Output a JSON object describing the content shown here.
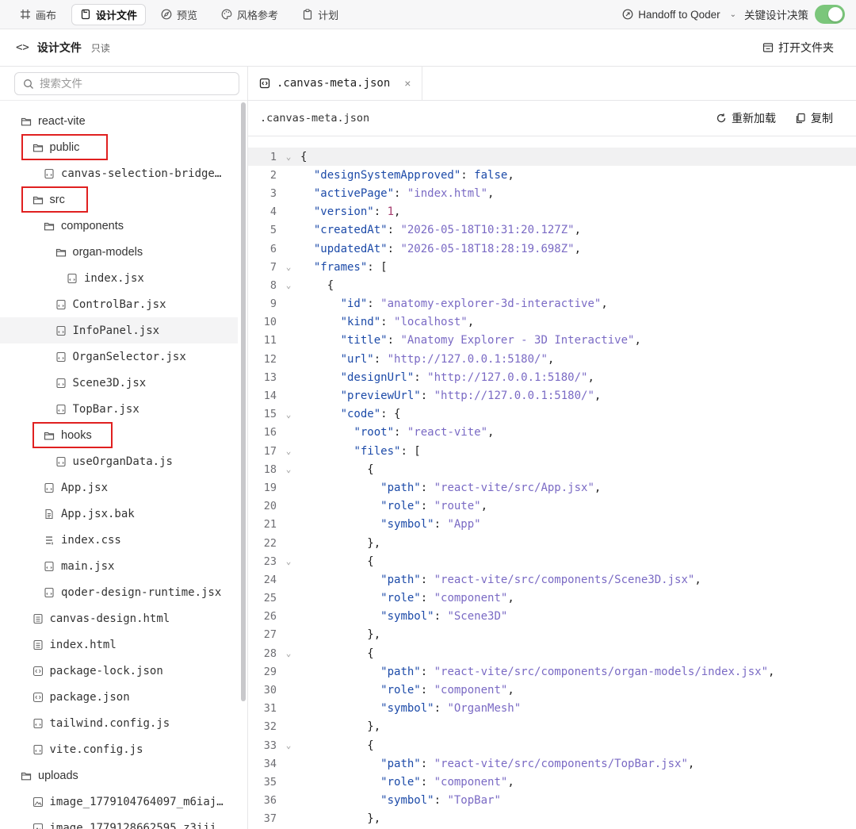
{
  "topnav": {
    "tabs": [
      {
        "label": "画布",
        "icon": "grid-icon",
        "active": false
      },
      {
        "label": "设计文件",
        "icon": "file-icon",
        "active": true
      },
      {
        "label": "预览",
        "icon": "compass-icon",
        "active": false
      },
      {
        "label": "风格参考",
        "icon": "palette-icon",
        "active": false
      },
      {
        "label": "计划",
        "icon": "clipboard-icon",
        "active": false
      }
    ],
    "handoff_label": "Handoff to Qoder",
    "decision_label": "关键设计决策",
    "decision_toggle_on": true,
    "toggle_color": "#7bc67b"
  },
  "subheader": {
    "title": "设计文件",
    "readonly": "只读",
    "open_folder": "打开文件夹"
  },
  "sidebar": {
    "search_placeholder": "搜索文件",
    "tree": [
      {
        "label": "react-vite",
        "type": "folder",
        "depth": 0
      },
      {
        "label": "public",
        "type": "folder",
        "depth": 1,
        "highlighted": true
      },
      {
        "label": "canvas-selection-bridge…",
        "type": "file",
        "depth": 2
      },
      {
        "label": "src",
        "type": "folder",
        "depth": 1,
        "highlighted": true
      },
      {
        "label": "components",
        "type": "folder",
        "depth": 2
      },
      {
        "label": "organ-models",
        "type": "folder",
        "depth": 3
      },
      {
        "label": "index.jsx",
        "type": "file",
        "depth": 4
      },
      {
        "label": "ControlBar.jsx",
        "type": "file",
        "depth": 3
      },
      {
        "label": "InfoPanel.jsx",
        "type": "file",
        "depth": 3,
        "selected": true
      },
      {
        "label": "OrganSelector.jsx",
        "type": "file",
        "depth": 3
      },
      {
        "label": "Scene3D.jsx",
        "type": "file",
        "depth": 3
      },
      {
        "label": "TopBar.jsx",
        "type": "file",
        "depth": 3
      },
      {
        "label": "hooks",
        "type": "folder",
        "depth": 2,
        "highlighted": true
      },
      {
        "label": "useOrganData.js",
        "type": "file",
        "depth": 3
      },
      {
        "label": "App.jsx",
        "type": "file",
        "depth": 2
      },
      {
        "label": "App.jsx.bak",
        "type": "doc",
        "depth": 2
      },
      {
        "label": "index.css",
        "type": "css",
        "depth": 2
      },
      {
        "label": "main.jsx",
        "type": "file",
        "depth": 2
      },
      {
        "label": "qoder-design-runtime.jsx",
        "type": "file",
        "depth": 2
      },
      {
        "label": "canvas-design.html",
        "type": "html",
        "depth": 1
      },
      {
        "label": "index.html",
        "type": "html",
        "depth": 1
      },
      {
        "label": "package-lock.json",
        "type": "json",
        "depth": 1
      },
      {
        "label": "package.json",
        "type": "json",
        "depth": 1
      },
      {
        "label": "tailwind.config.js",
        "type": "file",
        "depth": 1
      },
      {
        "label": "vite.config.js",
        "type": "file",
        "depth": 1
      },
      {
        "label": "uploads",
        "type": "folder",
        "depth": 0
      },
      {
        "label": "image_1779104764097_m6iaj…",
        "type": "image",
        "depth": 1
      },
      {
        "label": "image_1779128662595_z3iii…",
        "type": "image",
        "depth": 1
      }
    ]
  },
  "editor": {
    "tab_label": ".canvas-meta.json",
    "tab_close": "×",
    "file_name": ".canvas-meta.json",
    "reload_label": "重新加载",
    "copy_label": "复制",
    "lines": [
      {
        "n": "1",
        "fold": true,
        "current": true,
        "t": [
          [
            "p",
            "{"
          ]
        ]
      },
      {
        "n": "2",
        "t": [
          [
            "p",
            "  "
          ],
          [
            "k",
            "\"designSystemApproved\""
          ],
          [
            "p",
            ": "
          ],
          [
            "b",
            "false"
          ],
          [
            "p",
            ","
          ]
        ]
      },
      {
        "n": "3",
        "t": [
          [
            "p",
            "  "
          ],
          [
            "k",
            "\"activePage\""
          ],
          [
            "p",
            ": "
          ],
          [
            "s",
            "\"index.html\""
          ],
          [
            "p",
            ","
          ]
        ]
      },
      {
        "n": "4",
        "t": [
          [
            "p",
            "  "
          ],
          [
            "k",
            "\"version\""
          ],
          [
            "p",
            ": "
          ],
          [
            "n",
            "1"
          ],
          [
            "p",
            ","
          ]
        ]
      },
      {
        "n": "5",
        "t": [
          [
            "p",
            "  "
          ],
          [
            "k",
            "\"createdAt\""
          ],
          [
            "p",
            ": "
          ],
          [
            "s",
            "\"2026-05-18T10:31:20.127Z\""
          ],
          [
            "p",
            ","
          ]
        ]
      },
      {
        "n": "6",
        "t": [
          [
            "p",
            "  "
          ],
          [
            "k",
            "\"updatedAt\""
          ],
          [
            "p",
            ": "
          ],
          [
            "s",
            "\"2026-05-18T18:28:19.698Z\""
          ],
          [
            "p",
            ","
          ]
        ]
      },
      {
        "n": "7",
        "fold": true,
        "t": [
          [
            "p",
            "  "
          ],
          [
            "k",
            "\"frames\""
          ],
          [
            "p",
            ": ["
          ]
        ]
      },
      {
        "n": "8",
        "fold": true,
        "t": [
          [
            "p",
            "    {"
          ]
        ]
      },
      {
        "n": "9",
        "t": [
          [
            "p",
            "      "
          ],
          [
            "k",
            "\"id\""
          ],
          [
            "p",
            ": "
          ],
          [
            "s",
            "\"anatomy-explorer-3d-interactive\""
          ],
          [
            "p",
            ","
          ]
        ]
      },
      {
        "n": "10",
        "t": [
          [
            "p",
            "      "
          ],
          [
            "k",
            "\"kind\""
          ],
          [
            "p",
            ": "
          ],
          [
            "s",
            "\"localhost\""
          ],
          [
            "p",
            ","
          ]
        ]
      },
      {
        "n": "11",
        "t": [
          [
            "p",
            "      "
          ],
          [
            "k",
            "\"title\""
          ],
          [
            "p",
            ": "
          ],
          [
            "s",
            "\"Anatomy Explorer - 3D Interactive\""
          ],
          [
            "p",
            ","
          ]
        ]
      },
      {
        "n": "12",
        "t": [
          [
            "p",
            "      "
          ],
          [
            "k",
            "\"url\""
          ],
          [
            "p",
            ": "
          ],
          [
            "s",
            "\"http://127.0.0.1:5180/\""
          ],
          [
            "p",
            ","
          ]
        ]
      },
      {
        "n": "13",
        "t": [
          [
            "p",
            "      "
          ],
          [
            "k",
            "\"designUrl\""
          ],
          [
            "p",
            ": "
          ],
          [
            "s",
            "\"http://127.0.0.1:5180/\""
          ],
          [
            "p",
            ","
          ]
        ]
      },
      {
        "n": "14",
        "t": [
          [
            "p",
            "      "
          ],
          [
            "k",
            "\"previewUrl\""
          ],
          [
            "p",
            ": "
          ],
          [
            "s",
            "\"http://127.0.0.1:5180/\""
          ],
          [
            "p",
            ","
          ]
        ]
      },
      {
        "n": "15",
        "fold": true,
        "t": [
          [
            "p",
            "      "
          ],
          [
            "k",
            "\"code\""
          ],
          [
            "p",
            ": {"
          ]
        ]
      },
      {
        "n": "16",
        "t": [
          [
            "p",
            "        "
          ],
          [
            "k",
            "\"root\""
          ],
          [
            "p",
            ": "
          ],
          [
            "s",
            "\"react-vite\""
          ],
          [
            "p",
            ","
          ]
        ]
      },
      {
        "n": "17",
        "fold": true,
        "t": [
          [
            "p",
            "        "
          ],
          [
            "k",
            "\"files\""
          ],
          [
            "p",
            ": ["
          ]
        ]
      },
      {
        "n": "18",
        "fold": true,
        "t": [
          [
            "p",
            "          {"
          ]
        ]
      },
      {
        "n": "19",
        "t": [
          [
            "p",
            "            "
          ],
          [
            "k",
            "\"path\""
          ],
          [
            "p",
            ": "
          ],
          [
            "s",
            "\"react-vite/src/App.jsx\""
          ],
          [
            "p",
            ","
          ]
        ]
      },
      {
        "n": "20",
        "t": [
          [
            "p",
            "            "
          ],
          [
            "k",
            "\"role\""
          ],
          [
            "p",
            ": "
          ],
          [
            "s",
            "\"route\""
          ],
          [
            "p",
            ","
          ]
        ]
      },
      {
        "n": "21",
        "t": [
          [
            "p",
            "            "
          ],
          [
            "k",
            "\"symbol\""
          ],
          [
            "p",
            ": "
          ],
          [
            "s",
            "\"App\""
          ]
        ]
      },
      {
        "n": "22",
        "t": [
          [
            "p",
            "          },"
          ]
        ]
      },
      {
        "n": "23",
        "fold": true,
        "t": [
          [
            "p",
            "          {"
          ]
        ]
      },
      {
        "n": "24",
        "t": [
          [
            "p",
            "            "
          ],
          [
            "k",
            "\"path\""
          ],
          [
            "p",
            ": "
          ],
          [
            "s",
            "\"react-vite/src/components/Scene3D.jsx\""
          ],
          [
            "p",
            ","
          ]
        ]
      },
      {
        "n": "25",
        "t": [
          [
            "p",
            "            "
          ],
          [
            "k",
            "\"role\""
          ],
          [
            "p",
            ": "
          ],
          [
            "s",
            "\"component\""
          ],
          [
            "p",
            ","
          ]
        ]
      },
      {
        "n": "26",
        "t": [
          [
            "p",
            "            "
          ],
          [
            "k",
            "\"symbol\""
          ],
          [
            "p",
            ": "
          ],
          [
            "s",
            "\"Scene3D\""
          ]
        ]
      },
      {
        "n": "27",
        "t": [
          [
            "p",
            "          },"
          ]
        ]
      },
      {
        "n": "28",
        "fold": true,
        "t": [
          [
            "p",
            "          {"
          ]
        ]
      },
      {
        "n": "29",
        "t": [
          [
            "p",
            "            "
          ],
          [
            "k",
            "\"path\""
          ],
          [
            "p",
            ": "
          ],
          [
            "s",
            "\"react-vite/src/components/organ-models/index.jsx\""
          ],
          [
            "p",
            ","
          ]
        ]
      },
      {
        "n": "30",
        "t": [
          [
            "p",
            "            "
          ],
          [
            "k",
            "\"role\""
          ],
          [
            "p",
            ": "
          ],
          [
            "s",
            "\"component\""
          ],
          [
            "p",
            ","
          ]
        ]
      },
      {
        "n": "31",
        "t": [
          [
            "p",
            "            "
          ],
          [
            "k",
            "\"symbol\""
          ],
          [
            "p",
            ": "
          ],
          [
            "s",
            "\"OrganMesh\""
          ]
        ]
      },
      {
        "n": "32",
        "t": [
          [
            "p",
            "          },"
          ]
        ]
      },
      {
        "n": "33",
        "fold": true,
        "t": [
          [
            "p",
            "          {"
          ]
        ]
      },
      {
        "n": "34",
        "t": [
          [
            "p",
            "            "
          ],
          [
            "k",
            "\"path\""
          ],
          [
            "p",
            ": "
          ],
          [
            "s",
            "\"react-vite/src/components/TopBar.jsx\""
          ],
          [
            "p",
            ","
          ]
        ]
      },
      {
        "n": "35",
        "t": [
          [
            "p",
            "            "
          ],
          [
            "k",
            "\"role\""
          ],
          [
            "p",
            ": "
          ],
          [
            "s",
            "\"component\""
          ],
          [
            "p",
            ","
          ]
        ]
      },
      {
        "n": "36",
        "t": [
          [
            "p",
            "            "
          ],
          [
            "k",
            "\"symbol\""
          ],
          [
            "p",
            ": "
          ],
          [
            "s",
            "\"TopBar\""
          ]
        ]
      },
      {
        "n": "37",
        "t": [
          [
            "p",
            "          },"
          ]
        ]
      }
    ]
  }
}
